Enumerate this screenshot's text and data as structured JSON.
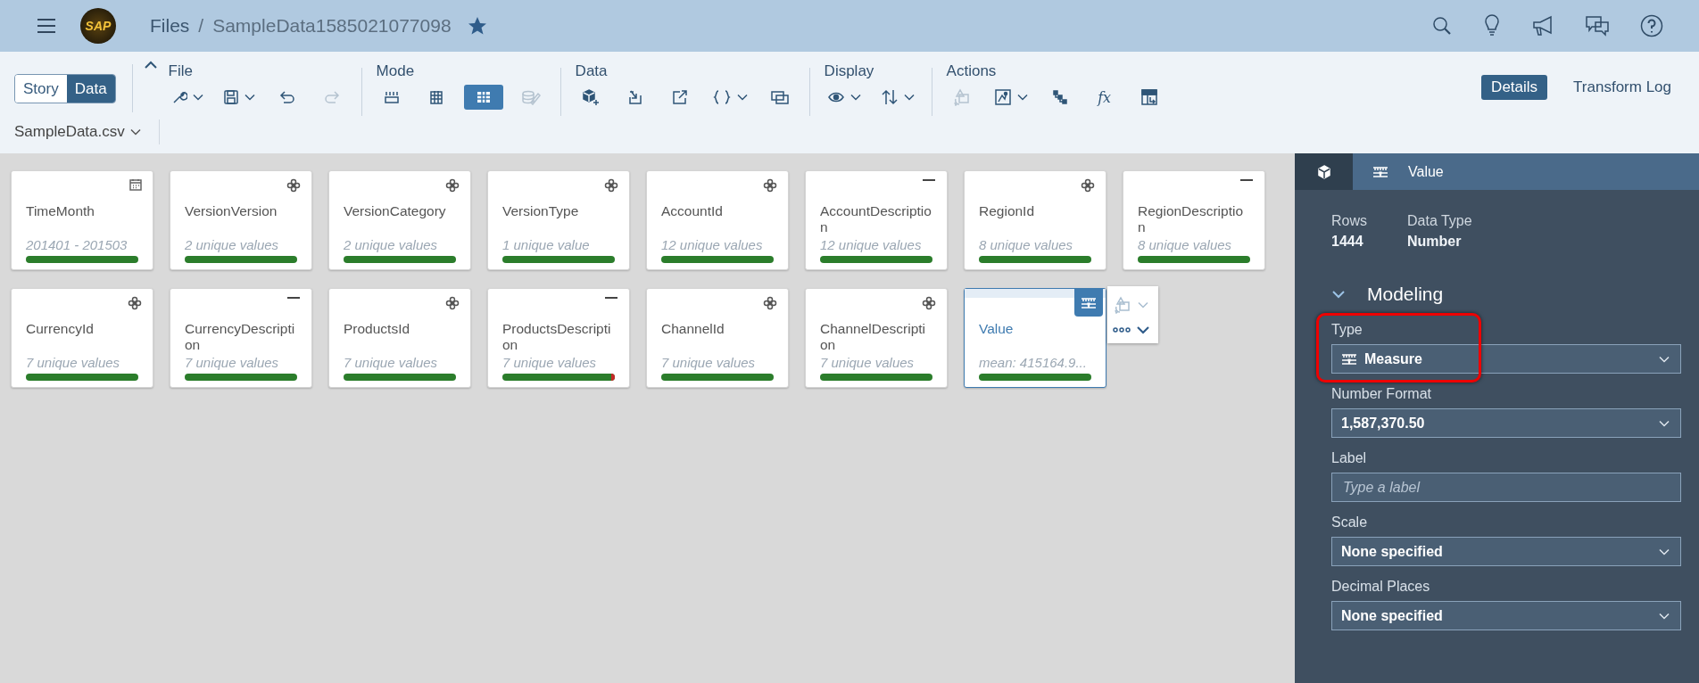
{
  "header": {
    "logo_text": "SAP",
    "root": "Files",
    "separator": "/",
    "title": "SampleData1585021077098",
    "favorite": true
  },
  "view_switch": [
    {
      "label": "Story",
      "selected": false
    },
    {
      "label": "Data",
      "selected": true
    }
  ],
  "toolbar_groups": [
    {
      "label": "File",
      "items": [
        {
          "kind": "wrench",
          "dropdown": true,
          "disabled": false
        },
        {
          "kind": "save",
          "dropdown": true,
          "disabled": false
        },
        {
          "kind": "undo",
          "dropdown": false,
          "disabled": false
        },
        {
          "kind": "redo",
          "dropdown": false,
          "disabled": true
        }
      ]
    },
    {
      "label": "Mode",
      "items": [
        {
          "kind": "columns",
          "dropdown": false,
          "disabled": false,
          "selected": false
        },
        {
          "kind": "grid",
          "dropdown": false,
          "disabled": false,
          "selected": false
        },
        {
          "kind": "table",
          "dropdown": false,
          "disabled": false,
          "selected": true
        },
        {
          "kind": "database-edit",
          "dropdown": false,
          "disabled": true,
          "selected": false
        }
      ]
    },
    {
      "label": "Data",
      "items": [
        {
          "kind": "cube-add",
          "dropdown": false,
          "disabled": false
        },
        {
          "kind": "import",
          "dropdown": false,
          "disabled": false
        },
        {
          "kind": "export",
          "dropdown": false,
          "disabled": false
        },
        {
          "kind": "braces",
          "dropdown": true,
          "disabled": false
        },
        {
          "kind": "layers",
          "dropdown": false,
          "disabled": false
        }
      ]
    },
    {
      "label": "Display",
      "items": [
        {
          "kind": "eye",
          "dropdown": true,
          "disabled": false
        },
        {
          "kind": "sort",
          "dropdown": true,
          "disabled": false
        }
      ]
    },
    {
      "label": "Actions",
      "items": [
        {
          "kind": "shapes",
          "dropdown": false,
          "disabled": true
        },
        {
          "kind": "image",
          "dropdown": true,
          "disabled": false
        },
        {
          "kind": "hierarchy",
          "dropdown": false,
          "disabled": false
        },
        {
          "kind": "formula",
          "text": "fx",
          "dropdown": false,
          "disabled": false
        },
        {
          "kind": "transform",
          "dropdown": false,
          "disabled": false
        }
      ]
    }
  ],
  "source": {
    "label": "SampleData.csv"
  },
  "panel_tabs": [
    {
      "label": "Details",
      "selected": true
    },
    {
      "label": "Transform Log",
      "selected": false
    }
  ],
  "cards": [
    {
      "name": "TimeMonth",
      "stat": "201401 - 201503",
      "kind": "date",
      "has_errors": false,
      "selected": false
    },
    {
      "name": "VersionVersion",
      "stat": "2 unique values",
      "kind": "dimension",
      "has_errors": false,
      "selected": false
    },
    {
      "name": "VersionCategory",
      "stat": "2 unique values",
      "kind": "dimension",
      "has_errors": false,
      "selected": false
    },
    {
      "name": "VersionType",
      "stat": "1 unique value",
      "kind": "dimension",
      "has_errors": false,
      "selected": false
    },
    {
      "name": "AccountId",
      "stat": "12 unique values",
      "kind": "dimension",
      "has_errors": false,
      "selected": false
    },
    {
      "name": "AccountDescription",
      "stat": "12 unique values",
      "kind": "description",
      "has_errors": false,
      "selected": false
    },
    {
      "name": "RegionId",
      "stat": "8 unique values",
      "kind": "dimension",
      "has_errors": false,
      "selected": false
    },
    {
      "name": "RegionDescription",
      "stat": "8 unique values",
      "kind": "description",
      "has_errors": false,
      "selected": false
    },
    {
      "name": "CurrencyId",
      "stat": "7 unique values",
      "kind": "dimension",
      "has_errors": false,
      "selected": false
    },
    {
      "name": "CurrencyDescription",
      "stat": "7 unique values",
      "kind": "description",
      "has_errors": false,
      "selected": false
    },
    {
      "name": "ProductsId",
      "stat": "7 unique values",
      "kind": "dimension",
      "has_errors": false,
      "selected": false
    },
    {
      "name": "ProductsDescription",
      "stat": "7 unique values",
      "kind": "description",
      "has_errors": true,
      "selected": false
    },
    {
      "name": "ChannelId",
      "stat": "7 unique values",
      "kind": "dimension",
      "has_errors": false,
      "selected": false
    },
    {
      "name": "ChannelDescription",
      "stat": "7 unique values",
      "kind": "dimension",
      "has_errors": false,
      "selected": false
    },
    {
      "name": "Value",
      "stat": "mean: 415164.9...",
      "kind": "measure",
      "has_errors": false,
      "selected": true
    }
  ],
  "side_panel": {
    "title": "Value",
    "stats": [
      {
        "label": "Rows",
        "value": "1444"
      },
      {
        "label": "Data Type",
        "value": "Number"
      }
    ],
    "section": {
      "title": "Modeling",
      "expanded": true
    },
    "fields": [
      {
        "label": "Type",
        "kind": "select",
        "value": "Measure",
        "with_icon": true,
        "highlighted": true
      },
      {
        "label": "Number Format",
        "kind": "select",
        "value": "1,587,370.50",
        "with_icon": false,
        "highlighted": false
      },
      {
        "label": "Label",
        "kind": "input",
        "placeholder": "Type a label",
        "highlighted": false
      },
      {
        "label": "Scale",
        "kind": "select",
        "value": "None specified",
        "with_icon": false,
        "highlighted": false
      },
      {
        "label": "Decimal Places",
        "kind": "select",
        "value": "None specified",
        "with_icon": false,
        "highlighted": false
      }
    ]
  }
}
